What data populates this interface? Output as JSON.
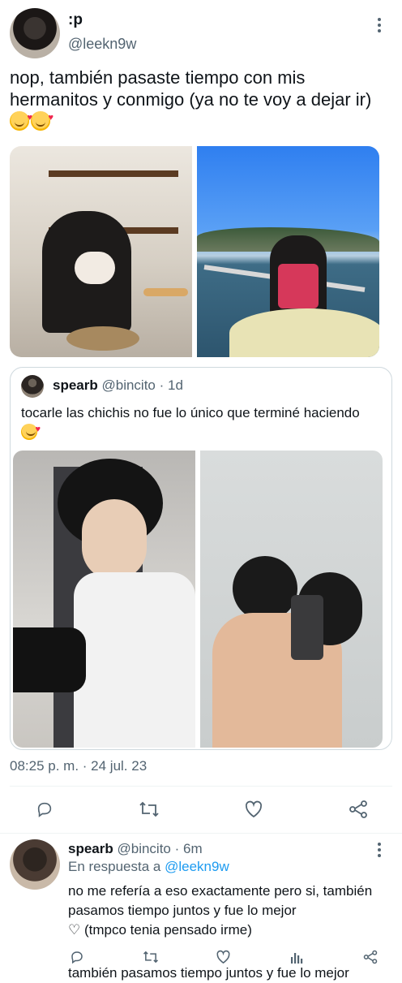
{
  "tweet": {
    "display_name": ":p",
    "handle": "@leekn9w",
    "text": "nop, también pasaste tiempo con mis hermanitos y conmigo (ya no te voy a dejar ir)",
    "timestamp": "08:25 p. m. · 24 jul. 23",
    "media": [
      "photo-1",
      "photo-2"
    ]
  },
  "quoted": {
    "display_name": "spearb",
    "handle": "@bincito",
    "time": "· 1d",
    "text": "tocarle las chichis no fue lo único que terminé haciendo",
    "media": [
      "photo-3",
      "photo-4"
    ]
  },
  "actions": [
    "reply-icon",
    "retweet-icon",
    "like-icon",
    "share-icon"
  ],
  "reply": {
    "display_name": "spearb",
    "handle": "@bincito",
    "time": "· 6m",
    "reply_prefix": "En respuesta a",
    "reply_to": "@leekn9w",
    "text": "no me refería a eso exactamente pero si, también pasamos tiempo juntos y fue lo mejor",
    "text2": "♡ (tmpco tenia pensado irme)",
    "cut_text": "también pasamos tiempo juntos y fue lo mejor",
    "actions": [
      "reply-icon",
      "retweet-icon",
      "like-icon",
      "views-icon",
      "share-icon"
    ]
  },
  "colors": {
    "link": "#1d9bf0",
    "muted": "#536471",
    "text": "#0f1419",
    "divider": "#eff3f4"
  }
}
